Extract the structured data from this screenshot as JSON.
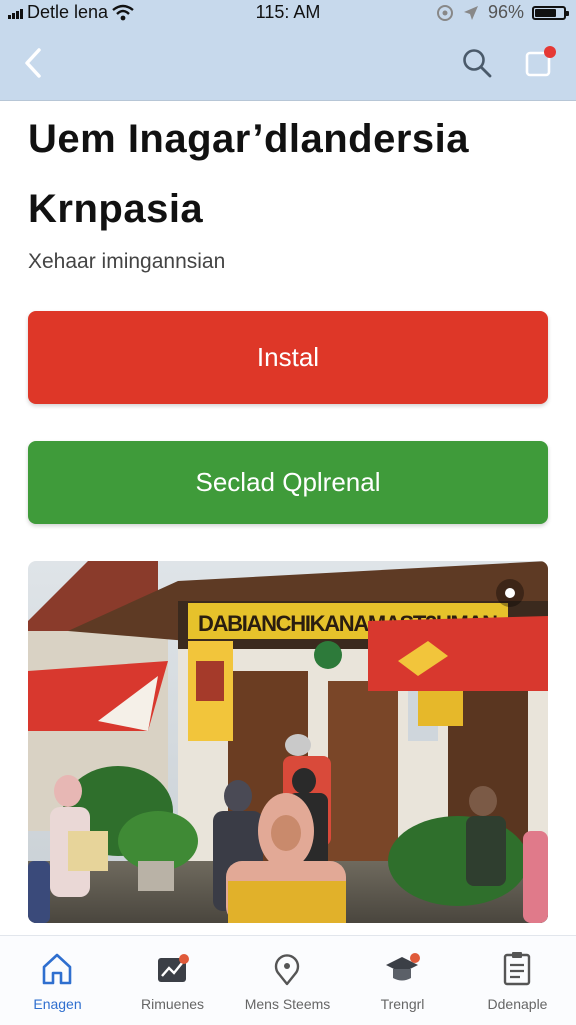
{
  "status_bar": {
    "carrier": "Detle lena",
    "time": "115: AM",
    "battery_percent": "96%",
    "battery_level": 0.8
  },
  "nav": {
    "back_icon": "chevron-left-icon",
    "search_icon": "search-icon",
    "notification_icon": "notification-icon"
  },
  "page": {
    "title": "Uem Inagar’dlandersia Krnpasia",
    "subtitle": "Xehaar imingannsian"
  },
  "actions": {
    "install_label": "Instal",
    "secondary_label": "Seclad Qplrenal"
  },
  "photo": {
    "banner_text": "DABIANCHIKANAMAST2UMAN"
  },
  "tabs": [
    {
      "label": "Enagen",
      "icon": "home-icon",
      "active": true
    },
    {
      "label": "Rimuenes",
      "icon": "chart-icon",
      "active": false
    },
    {
      "label": "Mens Steems",
      "icon": "location-pin-icon",
      "active": false
    },
    {
      "label": "Trengrl",
      "icon": "graduation-cap-icon",
      "active": false
    },
    {
      "label": "Ddenaple",
      "icon": "list-icon",
      "active": false
    }
  ],
  "colors": {
    "install": "#de3728",
    "secondary": "#3f9b3a",
    "header": "#c7d9ec",
    "active_tab": "#2f6fcf"
  }
}
